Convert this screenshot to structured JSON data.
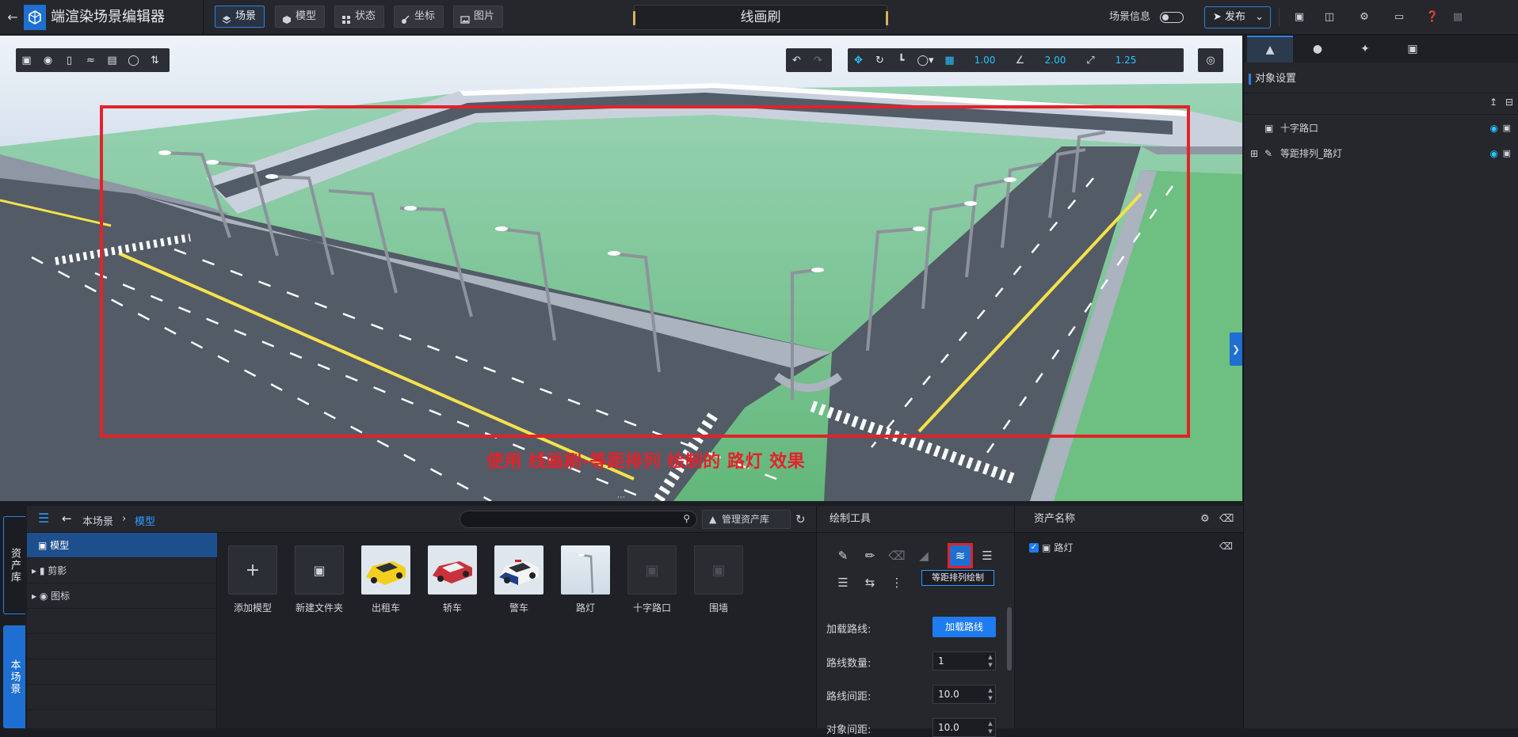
{
  "app": {
    "title": "端渲染场景编辑器",
    "mode_title": "线画刷"
  },
  "nav": {
    "tabs": [
      {
        "label": "场景",
        "icon": "layers-icon",
        "active": true
      },
      {
        "label": "模型",
        "icon": "cube-icon",
        "active": false
      },
      {
        "label": "状态",
        "icon": "grid-icon",
        "active": false
      },
      {
        "label": "坐标",
        "icon": "coordinate-icon",
        "active": false
      },
      {
        "label": "图片",
        "icon": "image-icon",
        "active": false
      }
    ]
  },
  "topright": {
    "scene_info": "场景信息",
    "publish": "发布"
  },
  "viewport": {
    "grid_snap": "1.00",
    "angle_snap": "2.00",
    "scale_snap": "1.25",
    "caption": "使用 线画刷-等距排列 绘制的 路灯 效果"
  },
  "right_panel": {
    "title": "对象设置",
    "tree": [
      {
        "label": "十字路口",
        "icon": "cube-icon"
      },
      {
        "label": "等距排列_路灯",
        "icon": "brush-icon"
      }
    ]
  },
  "side_tabs": {
    "assets": "资产库",
    "scene": "本场景"
  },
  "assets": {
    "breadcrumb": [
      "本场景",
      "模型"
    ],
    "manage_label": "管理资产库",
    "search_placeholder": "",
    "tree": [
      {
        "label": "模型"
      },
      {
        "label": "剪影"
      },
      {
        "label": "图标"
      }
    ],
    "cards": [
      {
        "label": "添加模型"
      },
      {
        "label": "新建文件夹"
      },
      {
        "label": "出租车"
      },
      {
        "label": "轿车"
      },
      {
        "label": "警车"
      },
      {
        "label": "路灯"
      },
      {
        "label": "十字路口"
      },
      {
        "label": "围墙"
      }
    ]
  },
  "draw_tools": {
    "title": "绘制工具",
    "tooltip": "等距排列绘制",
    "load_route_label": "加载路线:",
    "load_route_button": "加载路线",
    "route_count_label": "路线数量:",
    "route_count": "1",
    "route_spacing_label": "路线间距:",
    "route_spacing": "10.0",
    "object_spacing_label": "对象间距:",
    "object_spacing": "10.0"
  },
  "asset_names": {
    "title": "资产名称",
    "items": [
      {
        "label": "路灯"
      }
    ]
  },
  "colors": {
    "accent": "#1e6fd1",
    "highlight": "#e3222a",
    "value": "#29c4ff"
  }
}
